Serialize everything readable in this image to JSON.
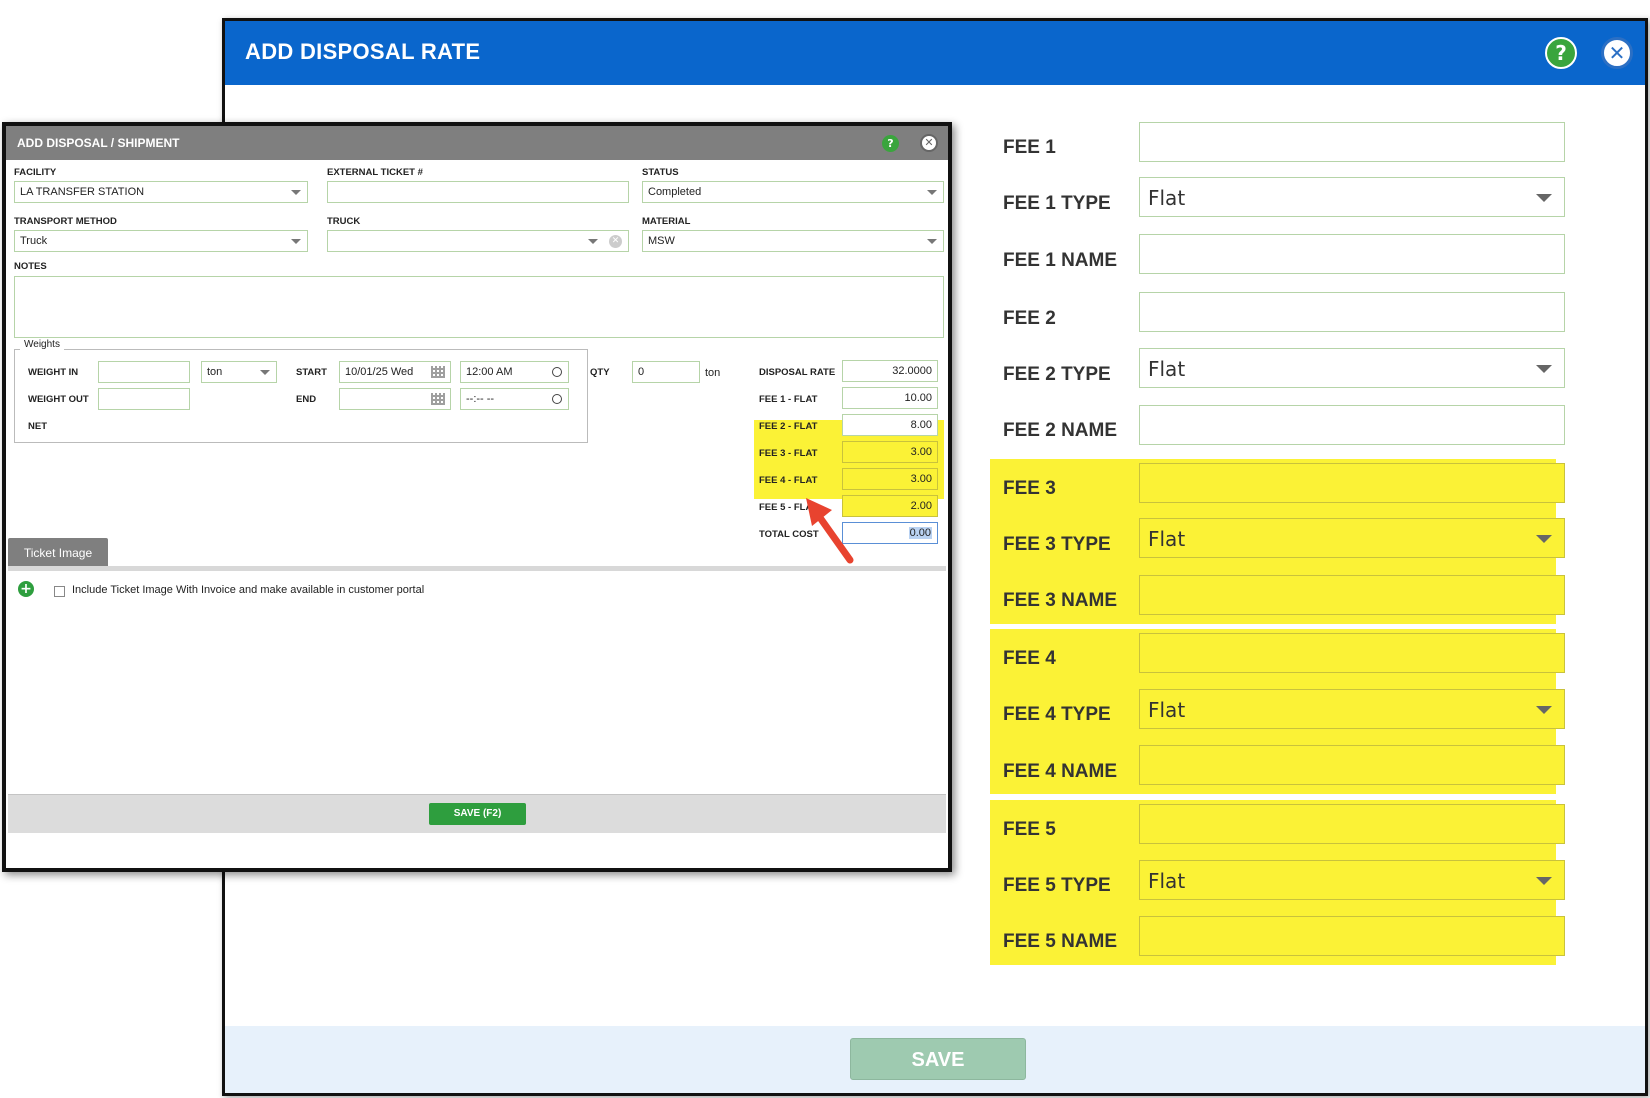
{
  "rate_dialog": {
    "title": "ADD DISPOSAL RATE",
    "help_symbol": "?",
    "close_symbol": "✕",
    "highlight_color": "#fbf236",
    "header_color": "#0a66cc",
    "save_label": "SAVE",
    "fees": [
      {
        "fee_label": "FEE 1",
        "type_label": "FEE 1 TYPE",
        "type_value": "Flat",
        "name_label": "FEE 1 NAME",
        "highlighted": false
      },
      {
        "fee_label": "FEE 2",
        "type_label": "FEE 2 TYPE",
        "type_value": "Flat",
        "name_label": "FEE 2 NAME",
        "highlighted": false
      },
      {
        "fee_label": "FEE 3",
        "type_label": "FEE 3 TYPE",
        "type_value": "Flat",
        "name_label": "FEE 3 NAME",
        "highlighted": true
      },
      {
        "fee_label": "FEE 4",
        "type_label": "FEE 4 TYPE",
        "type_value": "Flat",
        "name_label": "FEE 4 NAME",
        "highlighted": true
      },
      {
        "fee_label": "FEE 5",
        "type_label": "FEE 5 TYPE",
        "type_value": "Flat",
        "name_label": "FEE 5 NAME",
        "highlighted": true
      }
    ]
  },
  "shipment_dialog": {
    "title": "ADD DISPOSAL / SHIPMENT",
    "help_symbol": "?",
    "close_symbol": "✕",
    "facility": {
      "label": "FACILITY",
      "value": "LA TRANSFER STATION"
    },
    "external_ticket": {
      "label": "EXTERNAL TICKET #",
      "value": ""
    },
    "status": {
      "label": "STATUS",
      "value": "Completed"
    },
    "transport_method": {
      "label": "TRANSPORT METHOD",
      "value": "Truck"
    },
    "truck": {
      "label": "TRUCK",
      "value": ""
    },
    "material": {
      "label": "MATERIAL",
      "value": "MSW"
    },
    "notes": {
      "label": "NOTES",
      "value": ""
    },
    "weights": {
      "legend": "Weights",
      "weight_in_label": "WEIGHT IN",
      "weight_out_label": "WEIGHT OUT",
      "net_label": "NET",
      "unit": "ton",
      "start_label": "START",
      "start_date": "10/01/25 Wed",
      "start_time": "12:00 AM",
      "end_label": "END",
      "end_date": "",
      "end_time": "--:-- --"
    },
    "qty": {
      "label": "QTY",
      "value": "0",
      "unit": "ton"
    },
    "costs": [
      {
        "label": "DISPOSAL RATE",
        "value": "32.0000",
        "highlighted": false
      },
      {
        "label": "FEE 1 - FLAT",
        "value": "10.00",
        "highlighted": false
      },
      {
        "label": "FEE 2 - FLAT",
        "value": "8.00",
        "highlighted": false
      },
      {
        "label": "FEE 3 - FLAT",
        "value": "3.00",
        "highlighted": true
      },
      {
        "label": "FEE 4 - FLAT",
        "value": "3.00",
        "highlighted": true
      },
      {
        "label": "FEE 5 - FLAT",
        "value": "2.00",
        "highlighted": true
      }
    ],
    "total_cost": {
      "label": "TOTAL COST",
      "value": "0.00"
    },
    "ticket_tab": "Ticket Image",
    "include_label": "Include Ticket Image With Invoice and make available in customer portal",
    "save_label": "SAVE (F2)"
  },
  "annotation": {
    "arrow_color": "#e8432f",
    "arrow_target": "FEE 5 - FLAT"
  }
}
